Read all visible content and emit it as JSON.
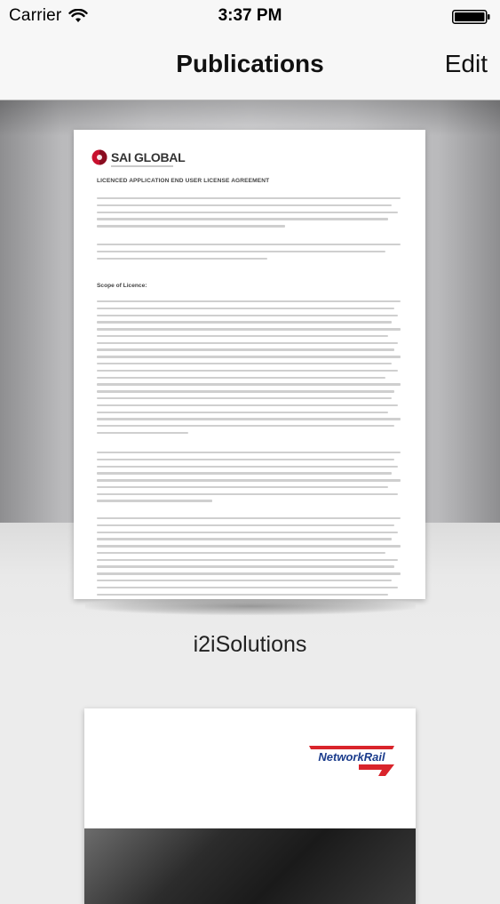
{
  "status_bar": {
    "carrier": "Carrier",
    "time": "3:37 PM"
  },
  "nav": {
    "title": "Publications",
    "edit_label": "Edit"
  },
  "publications": [
    {
      "title": "i2iSolutions",
      "cover": {
        "logo_text": "SAI GLOBAL",
        "heading": "LICENCED APPLICATION END USER LICENSE AGREEMENT",
        "subheading": "Scope of Licence:"
      }
    },
    {
      "title": "",
      "cover": {
        "logo_text": "NetworkRail"
      }
    }
  ],
  "colors": {
    "networkrail_red": "#d9242b",
    "networkrail_blue": "#1b3c8c",
    "sai_red": "#c8102e"
  }
}
